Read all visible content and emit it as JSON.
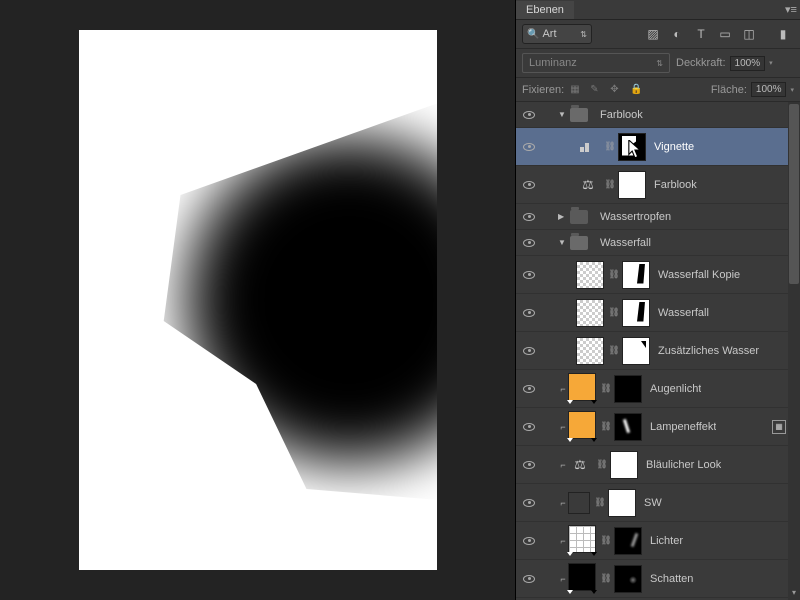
{
  "panel": {
    "title": "Ebenen"
  },
  "filter": {
    "label": "Art"
  },
  "blend": {
    "mode": "Luminanz",
    "opacity_label": "Deckkraft:",
    "opacity_value": "100%"
  },
  "lock": {
    "label": "Fixieren:",
    "fill_label": "Fläche:",
    "fill_value": "100%"
  },
  "layers": {
    "group_farblook": "Farblook",
    "vignette": "Vignette",
    "farblook": "Farblook",
    "group_wassertropfen": "Wassertropfen",
    "group_wasserfall": "Wasserfall",
    "wasserfall_kopie": "Wasserfall Kopie",
    "wasserfall": "Wasserfall",
    "zusatz_wasser": "Zusätzliches Wasser",
    "augenlicht": "Augenlicht",
    "lampeneffekt": "Lampeneffekt",
    "blaulicher": "Bläulicher Look",
    "sw": "SW",
    "lichter": "Lichter",
    "schatten": "Schatten"
  }
}
